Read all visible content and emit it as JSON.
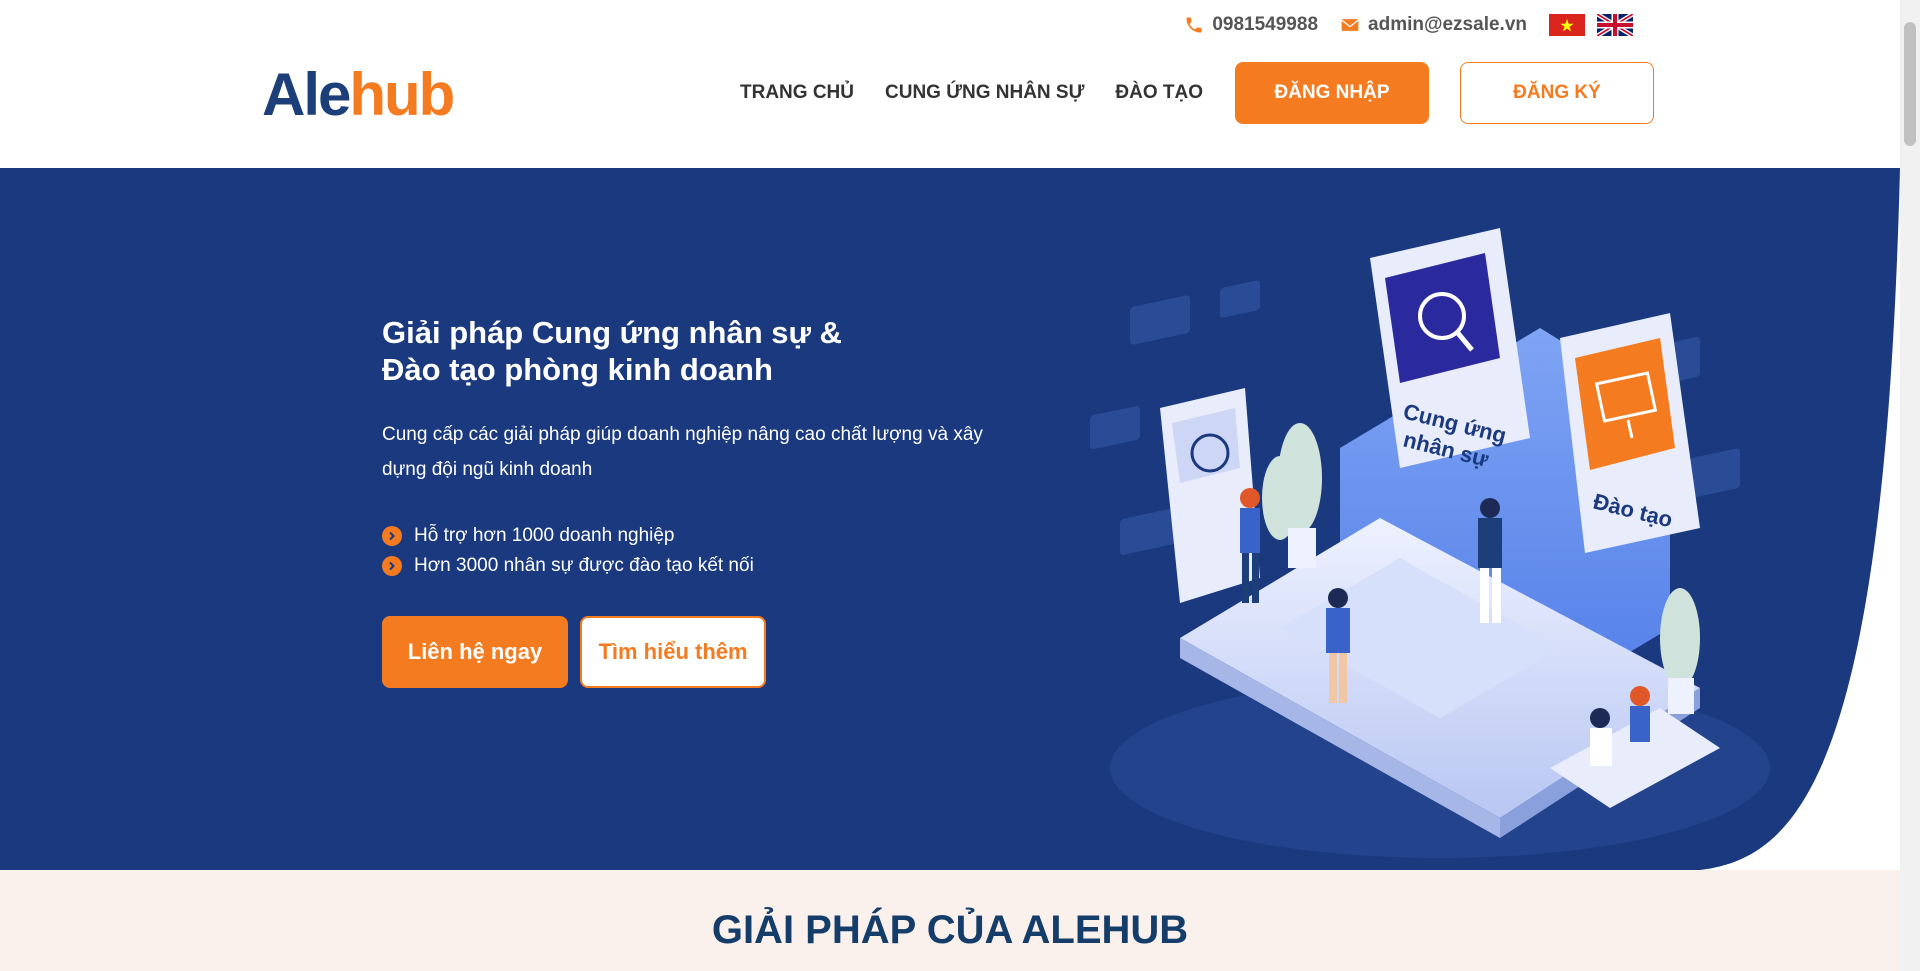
{
  "topbar": {
    "phone": "0981549988",
    "email": "admin@ezsale.vn",
    "icons": {
      "phone": "phone-icon",
      "email": "envelope-icon"
    },
    "flags": [
      "vietnam-flag-icon",
      "uk-flag-icon"
    ]
  },
  "header": {
    "logo_a": "Ale",
    "logo_hub": "hub",
    "nav": [
      {
        "label": "TRANG CHỦ"
      },
      {
        "label": "CUNG ỨNG NHÂN SỰ"
      },
      {
        "label": "ĐÀO TẠO"
      }
    ],
    "login_label": "ĐĂNG NHẬP",
    "register_label": "ĐĂNG KÝ"
  },
  "hero": {
    "title_line1": "Giải pháp Cung ứng nhân sự &",
    "title_line2": "Đào tạo phòng kinh doanh",
    "description": "Cung cấp các giải pháp giúp doanh nghiệp nâng cao chất lượng và xây dựng đội ngũ kinh doanh",
    "bullets": [
      {
        "text": "Hỗ trợ hơn 1000 doanh nghiệp"
      },
      {
        "text": "Hơn 3000 nhân sự được đào tạo kết nối"
      }
    ],
    "cta_primary": "Liên hệ ngay",
    "cta_secondary": "Tìm hiểu thêm",
    "illustration": {
      "card1_label_line1": "Cung ứng",
      "card1_label_line2": "nhân sự",
      "card2_label": "Đào tạo"
    }
  },
  "section": {
    "title": "GIẢI PHÁP CỦA ALEHUB"
  },
  "colors": {
    "brand_orange": "#f47b20",
    "hero_blue": "#1a397e",
    "logo_blue": "#1d3f79",
    "section_bg": "#fbf1ec",
    "section_title": "#153d6a"
  }
}
